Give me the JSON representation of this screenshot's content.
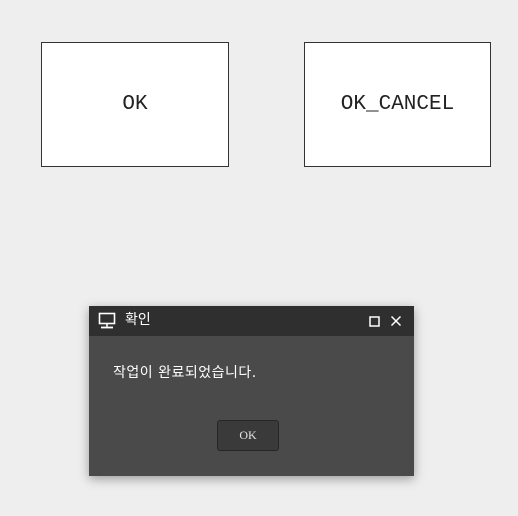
{
  "buttons": {
    "ok_label": "OK",
    "ok_cancel_label": "OK_CANCEL"
  },
  "dialog": {
    "title": "확인",
    "message": "작업이 완료되었습니다.",
    "ok_label": "OK",
    "icons": {
      "app": "monitor-icon",
      "maximize": "maximize-icon",
      "close": "close-icon"
    }
  },
  "colors": {
    "page_background": "#eeeeee",
    "dialog_background": "#4a4a4a",
    "titlebar_background": "#2f2f2f",
    "dialog_text": "#ffffff"
  }
}
